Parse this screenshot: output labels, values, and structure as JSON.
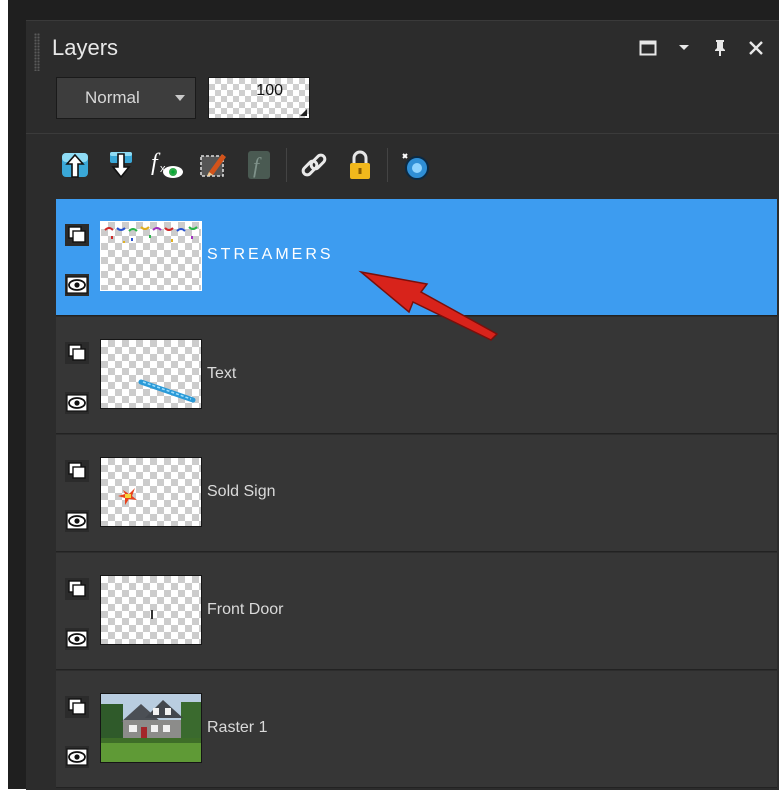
{
  "panel": {
    "title": "Layers",
    "blend_mode": "Normal",
    "opacity": "100",
    "title_icons": [
      "maximize-icon",
      "dropdown-icon",
      "pin-icon",
      "close-icon"
    ]
  },
  "toolbar": [
    "move-layer-up-icon",
    "move-layer-down-icon",
    "layer-effects-icon",
    "edit-selection-icon",
    "script-icon",
    "link-icon",
    "lock-icon",
    "new-mask-icon"
  ],
  "layers": [
    {
      "name": "STREAMERS",
      "selected": true
    },
    {
      "name": "Text",
      "selected": false
    },
    {
      "name": "Sold Sign",
      "selected": false
    },
    {
      "name": "Front Door",
      "selected": false
    },
    {
      "name": "Raster 1",
      "selected": false
    }
  ],
  "colors": {
    "selection": "#3d9cf0",
    "panel_bg": "#2c2c2c",
    "layer_bg": "#363636",
    "annotation_arrow": "#d8231b"
  }
}
